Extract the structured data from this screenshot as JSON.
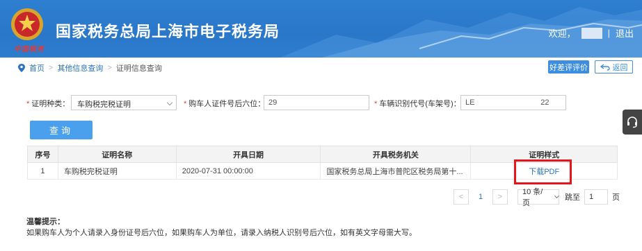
{
  "header": {
    "site_title": "国家税务总局上海市电子税务局",
    "brand_signature": "中国税务",
    "welcome": "欢迎，",
    "divider": "|",
    "logout": "退出"
  },
  "breadcrumb": {
    "home": "首页",
    "sep1": ">",
    "level2": "其他信息查询",
    "sep2": ">",
    "current": "证明信息查询"
  },
  "actions": {
    "evaluate": "好差评评价",
    "back": "返回"
  },
  "form": {
    "cert_type_label": "证明种类：",
    "cert_type_value": "车购税完税证明",
    "id_last6_label": "购车人证件号后六位：",
    "id_last6_value": "29",
    "vin_label": "车辆识别代号(车架号)：",
    "vin_value": "LE                               22",
    "required_mark": "*",
    "query_button": "查询"
  },
  "table": {
    "headers": [
      "序号",
      "证明名称",
      "开具日期",
      "开具税务机关",
      "证明样式"
    ],
    "rows": [
      {
        "index": "1",
        "name": "车购税完税证明",
        "date": "2020-07-31 00:00:00",
        "authority": "国家税务总局上海市普陀区税务局第十...",
        "style_link": "下载PDF"
      }
    ]
  },
  "pagination": {
    "prev": "<",
    "current_page": "1",
    "next": ">",
    "page_size": "10 条/页",
    "goto_label": "跳至",
    "goto_value": "1",
    "goto_unit": "页"
  },
  "tips": {
    "title": "温馨提示：",
    "text": "如果购车人为个人请录入身份证号后六位，如果购车人为单位，请录入纳税人识别号后六位，如有英文字母需大写。"
  },
  "colors": {
    "header_blue": "#2e7fd1",
    "link_blue": "#2b74c4",
    "button_blue": "#4aa0ec",
    "highlight_red": "#e8141b",
    "required_red": "#e03a3a"
  },
  "icons": {
    "emblem": "tax-emblem-icon",
    "location": "location-pin-icon",
    "back": "back-arrow-icon",
    "help": "headset-icon"
  }
}
